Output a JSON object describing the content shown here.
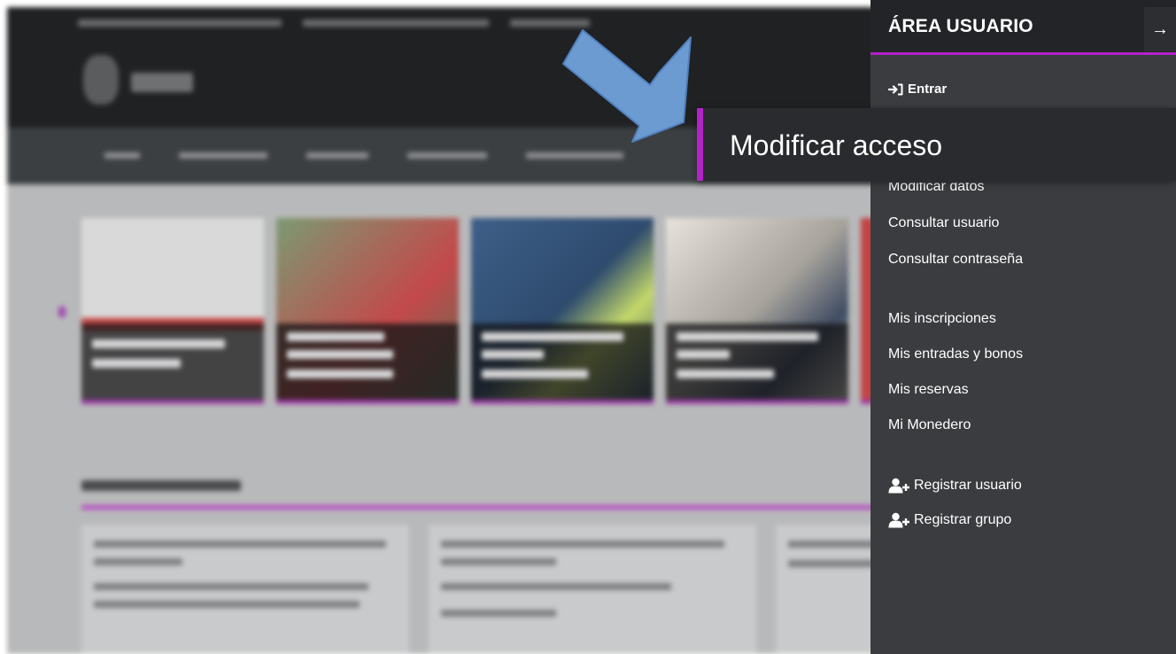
{
  "panel": {
    "title": "ÁREA USUARIO",
    "close_icon": "arrow-right-icon",
    "login_label": "Entrar",
    "login_icon": "sign-in-icon",
    "highlighted_item": "Modificar acceso",
    "account_items": [
      "Modificar datos",
      "Consultar usuario",
      "Consultar contraseña"
    ],
    "activity_items": [
      "Mis inscripciones",
      "Mis entradas y bonos",
      "Mis reservas",
      "Mi Monedero"
    ],
    "register_items": [
      {
        "label": "Registrar usuario",
        "icon": "user-plus-icon"
      },
      {
        "label": "Registrar grupo",
        "icon": "user-plus-icon"
      }
    ]
  },
  "annotation": {
    "arrow_color": "#6c9bd1",
    "arrow_outline": "#4f7fbd",
    "icon": "arrow-pointer-icon"
  },
  "colors": {
    "accent": "#b223c9",
    "panel_bg": "#3a3c3f",
    "header_bg": "#222427"
  }
}
